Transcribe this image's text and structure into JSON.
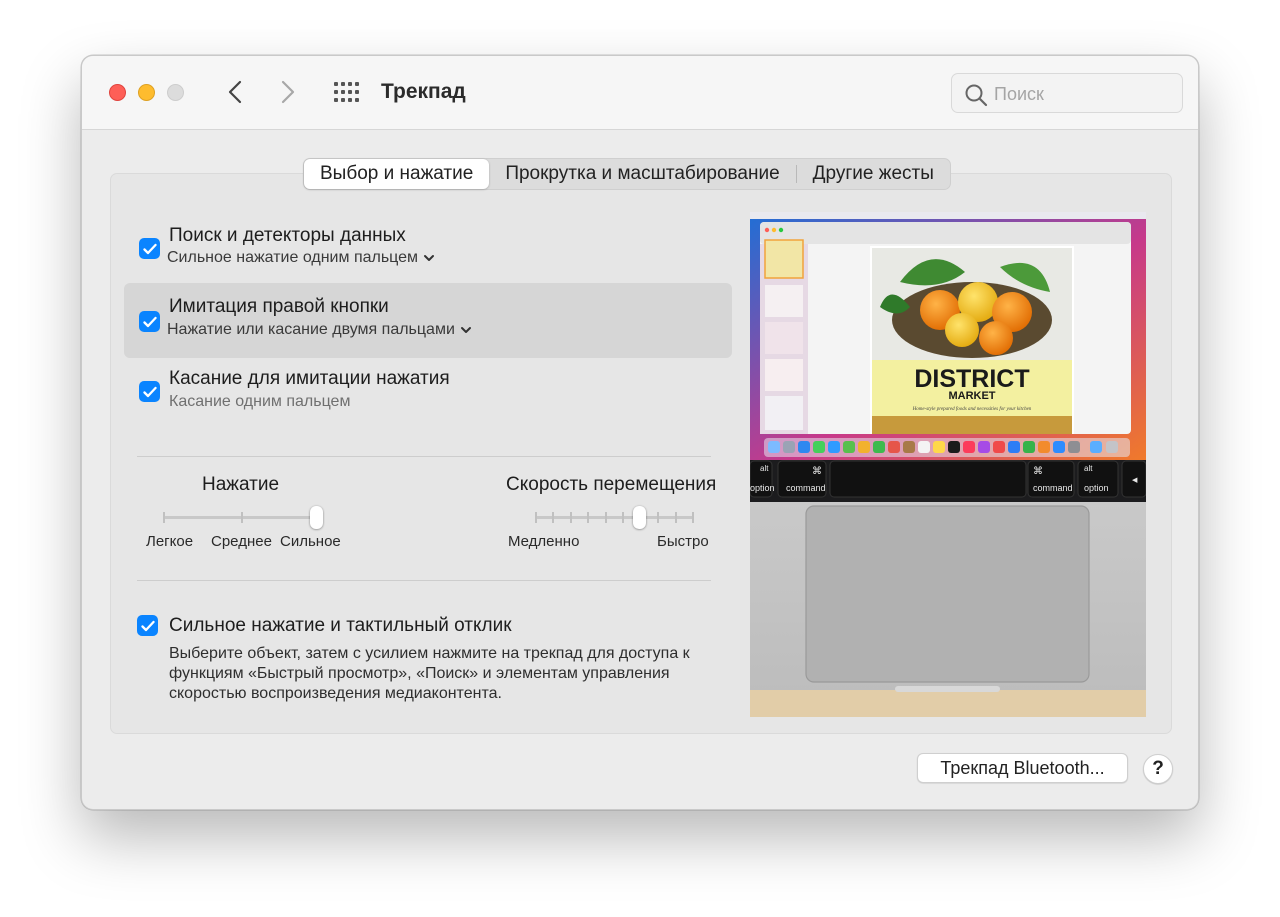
{
  "window": {
    "title": "Трекпад"
  },
  "search": {
    "placeholder": "Поиск"
  },
  "tabs": [
    {
      "label": "Выбор и нажатие",
      "selected": true
    },
    {
      "label": "Прокрутка и масштабирование",
      "selected": false
    },
    {
      "label": "Другие жесты",
      "selected": false
    }
  ],
  "options": [
    {
      "title": "Поиск и детекторы данных",
      "subtitle": "Сильное нажатие одним пальцем",
      "checked": true,
      "has_dropdown": true
    },
    {
      "title": "Имитация правой кнопки",
      "subtitle": "Нажатие или касание двумя пальцами",
      "checked": true,
      "has_dropdown": true
    },
    {
      "title": "Касание для имитации нажатия",
      "subtitle": "Касание одним пальцем",
      "checked": true,
      "has_dropdown": false
    }
  ],
  "click_slider": {
    "label": "Нажатие",
    "ticks": [
      "Легкое",
      "Среднее",
      "Сильное"
    ],
    "value_index": 2
  },
  "speed_slider": {
    "label": "Скорость перемещения",
    "min_label": "Медленно",
    "max_label": "Быстро",
    "tick_count": 10,
    "value_index": 6
  },
  "force_click": {
    "title": "Сильное нажатие и тактильный отклик",
    "checked": true,
    "description": "Выберите объект, затем с усилием нажмите на трекпад для доступа к функциям «Быстрый просмотр», «Поиск» и элементам управления скоростью воспроизведения медиаконтента."
  },
  "preview": {
    "doc_title": "DISTRICT",
    "doc_subtitle": "MARKET",
    "doc_tagline": "Home-style prepared foods and necessities for your kitchen",
    "key_left_alt": "alt",
    "key_left_option": "option",
    "key_left_cmd_symbol": "⌘",
    "key_left_command": "command",
    "key_right_cmd_symbol": "⌘",
    "key_right_command": "command",
    "key_right_alt": "alt",
    "key_right_option": "option",
    "key_arrow": "◀"
  },
  "buttons": {
    "bluetooth": "Трекпад Bluetooth...",
    "help": "?"
  },
  "colors": {
    "accent": "#0a84ff",
    "close": "#fe5f57",
    "minimize": "#febc2e"
  }
}
